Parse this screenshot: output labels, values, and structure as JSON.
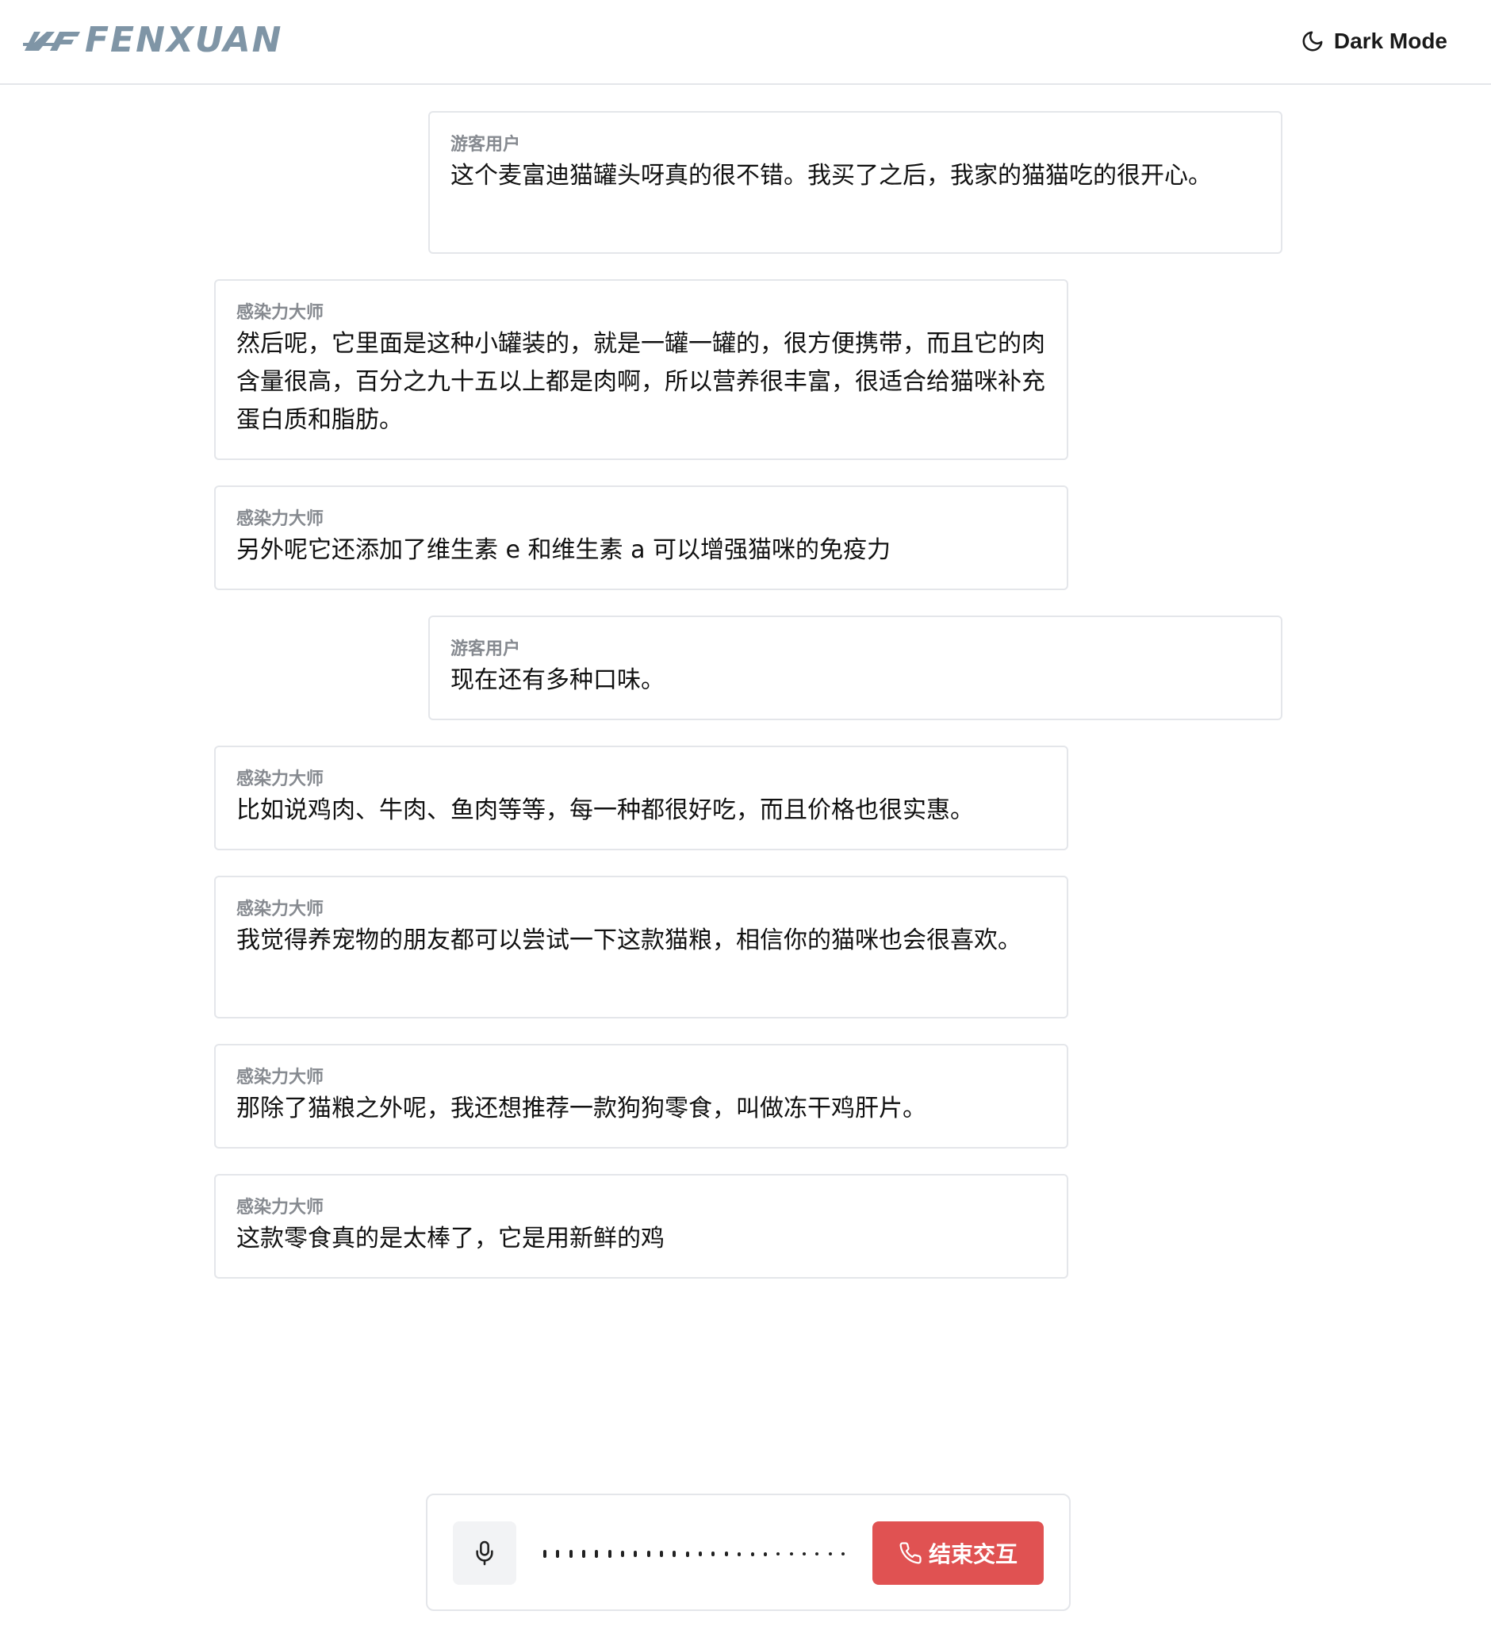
{
  "header": {
    "logo_text": "FENXUAN",
    "dark_mode_label": "Dark Mode",
    "dark_mode_icon": "moon-icon"
  },
  "colors": {
    "logo": "#7f95a6",
    "border": "#e4e6ea",
    "sender": "#868a90",
    "end_button": "#e05252",
    "mic_button_bg": "#f2f3f5"
  },
  "messages": [
    {
      "role": "user",
      "sender": "游客用户",
      "text": "这个麦富迪猫罐头呀真的很不错。我买了之后，我家的猫猫吃的很开心。"
    },
    {
      "role": "bot",
      "sender": "感染力大师",
      "text": "然后呢，它里面是这种小罐装的，就是一罐一罐的，很方便携带，而且它的肉含量很高，百分之九十五以上都是肉啊，所以营养很丰富，很适合给猫咪补充蛋白质和脂肪。"
    },
    {
      "role": "bot",
      "sender": "感染力大师",
      "text": "另外呢它还添加了维生素 e 和维生素 a 可以增强猫咪的免疫力"
    },
    {
      "role": "user",
      "sender": "游客用户",
      "text": "现在还有多种口味。"
    },
    {
      "role": "bot",
      "sender": "感染力大师",
      "text": "比如说鸡肉、牛肉、鱼肉等等，每一种都很好吃，而且价格也很实惠。"
    },
    {
      "role": "bot",
      "sender": "感染力大师",
      "text": "我觉得养宠物的朋友都可以尝试一下这款猫粮，相信你的猫咪也会很喜欢。"
    },
    {
      "role": "bot",
      "sender": "感染力大师",
      "text": "那除了猫粮之外呢，我还想推荐一款狗狗零食，叫做冻干鸡肝片。"
    },
    {
      "role": "bot",
      "sender": "感染力大师",
      "text": "这款零食真的是太棒了，它是用新鲜的鸡"
    }
  ],
  "composer": {
    "mic_icon": "microphone-icon",
    "end_button_label": "结束交互",
    "end_button_icon": "phone-icon"
  }
}
